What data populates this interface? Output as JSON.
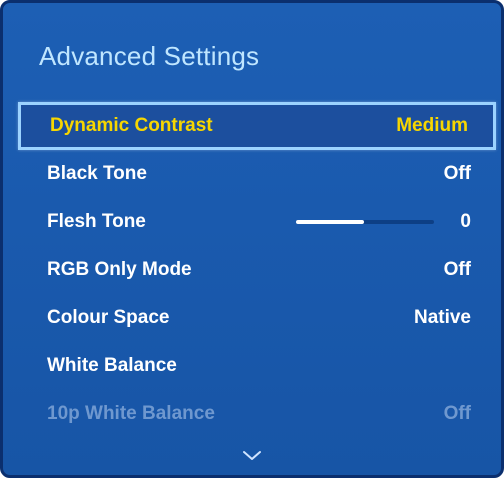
{
  "menu": {
    "title": "Advanced Settings",
    "items": [
      {
        "label": "Dynamic Contrast",
        "value": "Medium",
        "selected": true
      },
      {
        "label": "Black Tone",
        "value": "Off"
      },
      {
        "label": "Flesh Tone",
        "value": "0",
        "slider_level": 0.49
      },
      {
        "label": "RGB Only Mode",
        "value": "Off"
      },
      {
        "label": "Colour Space",
        "value": "Native"
      },
      {
        "label": "White Balance",
        "value": ""
      },
      {
        "label": "10p White Balance",
        "value": "Off",
        "disabled": true
      }
    ],
    "scroll_icon": "chevron-down-icon"
  },
  "colors": {
    "panel_blue": "#1a5aae",
    "title_text": "#bfe6ff",
    "selected_text": "#f7d600",
    "disabled_text": "#6f98cf",
    "selected_border": "#9cd3ff"
  }
}
